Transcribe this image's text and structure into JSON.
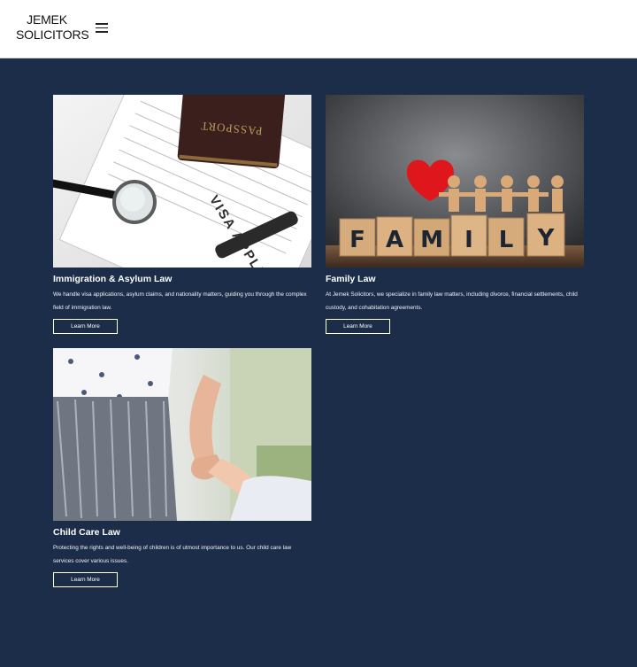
{
  "header": {
    "logo_line1": "JEMEK",
    "logo_line2": "SOLICITORS"
  },
  "services": [
    {
      "title": "Immigration & Asylum Law",
      "description": "We handle visa applications, asylum claims, and nationality matters, guiding you through the complex field of immigration law.",
      "button": "Learn More",
      "image_text": {
        "passport": "PASSPORT",
        "form": "VISA APPLICATION"
      }
    },
    {
      "title": "Family Law",
      "description": "At Jemek Solicitors, we specialize in family law matters, including divorce, financial settlements, child custody, and cohabitation agreements.",
      "button": "Learn More",
      "image_letters": [
        "F",
        "A",
        "M",
        "I",
        "L",
        "Y"
      ]
    },
    {
      "title": "Child Care Law",
      "description": "Protecting the rights and well-being of children is of utmost importance to us. Our child care law services cover various issues.",
      "button": "Learn More"
    }
  ]
}
